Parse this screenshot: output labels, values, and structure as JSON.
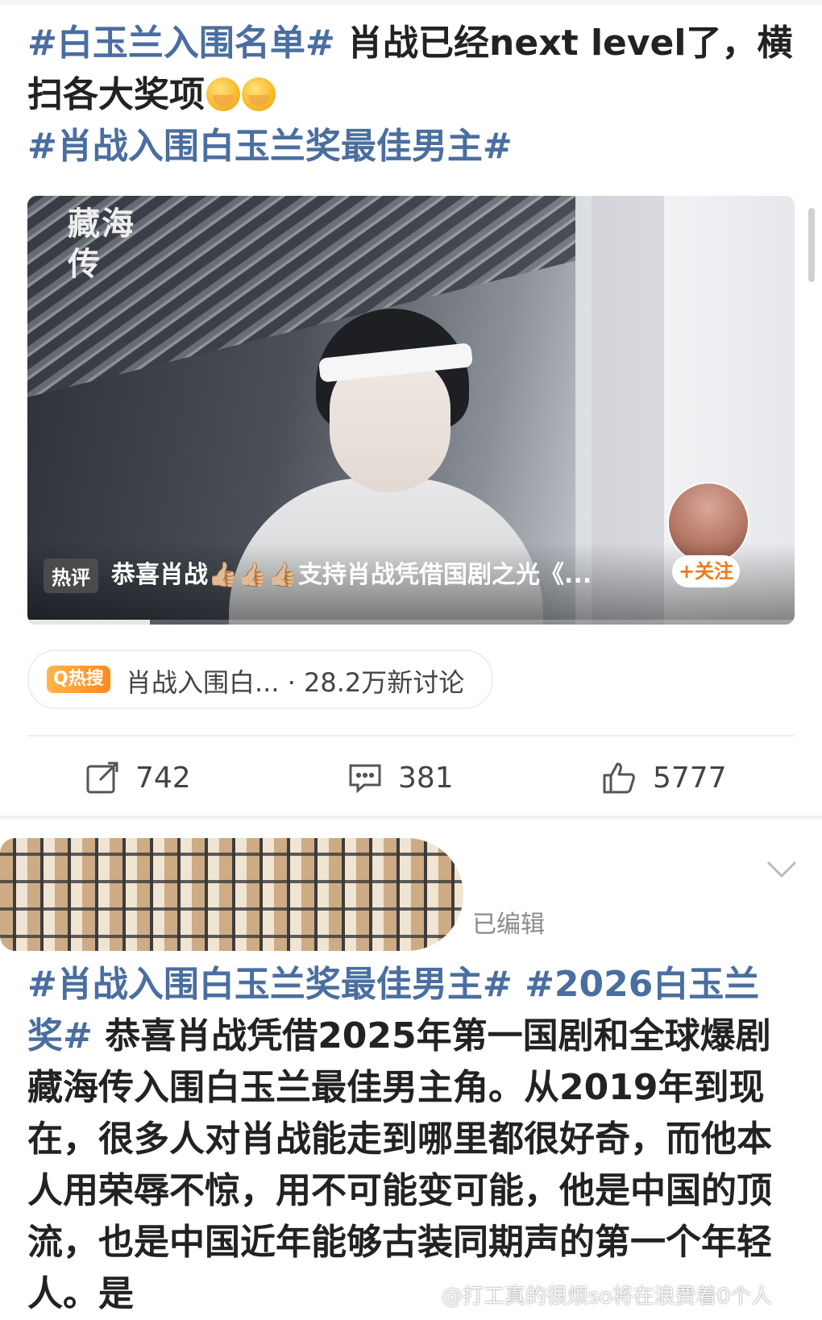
{
  "post1": {
    "topic_a": "#白玉兰入围名单#",
    "text_a": " 肖战已经next level了，横扫各大奖项",
    "emojis": [
      "blushing-face-emoji",
      "blushing-face-emoji"
    ],
    "topic_b": "#肖战入围白玉兰奖最佳男主#"
  },
  "video": {
    "logo_text": "藏海传",
    "hot_tag": "热评",
    "comment": "恭喜肖战👍🏼👍🏼👍🏼支持肖战凭借国剧之光《...",
    "follow_label": "+关注",
    "progress": 0.16
  },
  "trending": {
    "badge": "Q热搜",
    "text": "肖战入围白... · 28.2万新讨论"
  },
  "actions": {
    "repost_count": "742",
    "comment_count": "381",
    "like_count": "5777"
  },
  "post2": {
    "edited_label": "已编辑",
    "topic_a": "#肖战入围白玉兰奖最佳男主#",
    "topic_b": "#2026白玉兰奖#",
    "body": " 恭喜肖战凭借2025年第一国剧和全球爆剧藏海传入围白玉兰最佳男主角。从2019年到现在，很多人对肖战能走到哪里都很好奇，而他本人用荣辱不惊，用不可能变可能，他是中国的顶流，也是中国近年能够古装同期声的第一个年轻人。是"
  },
  "watermark": "@打工真的很烦so将在浪费着0个人",
  "colors": {
    "topic": "#4a6ea0",
    "accent_orange": "#f07a1a"
  }
}
